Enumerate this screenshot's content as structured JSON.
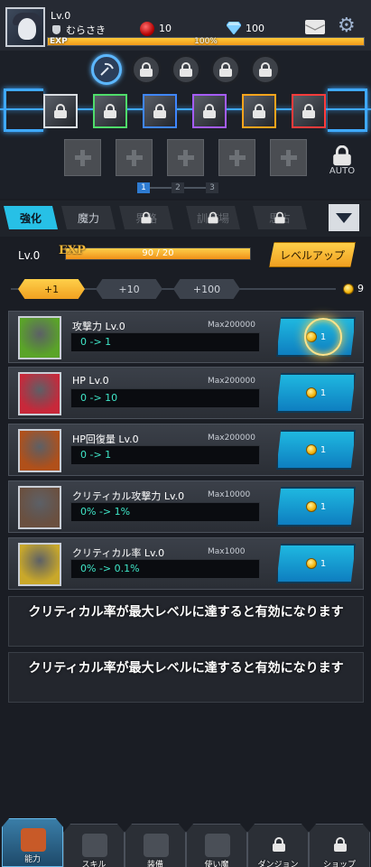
{
  "player": {
    "level": "Lv.0",
    "name": "むらさき",
    "red_gems": "10",
    "diamonds": "100",
    "exp_label": "EXP",
    "exp_percent": "100%",
    "exp_fraction": 1.0
  },
  "equipment": {
    "page_numbers": [
      "1",
      "2",
      "3"
    ],
    "active_page": 0,
    "auto_label": "AUTO",
    "slot_colors": [
      "#d9dde2",
      "#4fdc6a",
      "#3f86ff",
      "#a55cff",
      "#ffa41c",
      "#ff3b3b"
    ]
  },
  "tabs": {
    "strengthen": "強化",
    "magic": "魔力",
    "locked1": "界路",
    "locked2": "訓練場",
    "locked3": "思占"
  },
  "level_row": {
    "level": "Lv.0",
    "exp_tag": "EXP",
    "exp_value": "90 / 20",
    "exp_fraction": 1.0,
    "level_up": "レベルアップ"
  },
  "increments": {
    "options": [
      "+1",
      "+10",
      "+100"
    ],
    "active": 0,
    "coins": "9"
  },
  "upgrades": [
    {
      "title": "攻撃力 Lv.0",
      "max": "Max200000",
      "value": "0 -> 1",
      "cost": "1",
      "icon_color": "#5aa428"
    },
    {
      "title": "HP Lv.0",
      "max": "Max200000",
      "value": "0 -> 10",
      "cost": "1",
      "icon_color": "#c8283a"
    },
    {
      "title": "HP回復量 Lv.0",
      "max": "Max200000",
      "value": "0 -> 1",
      "cost": "1",
      "icon_color": "#b0501a"
    },
    {
      "title": "クリティカル攻撃力 Lv.0",
      "max": "Max10000",
      "value": "0% -> 1%",
      "cost": "1",
      "icon_color": "#6a5040"
    },
    {
      "title": "クリティカル率 Lv.0",
      "max": "Max1000",
      "value": "0% -> 0.1%",
      "cost": "1",
      "icon_color": "#c9a82a"
    }
  ],
  "notices": [
    "クリティカル率が最大レベルに達すると有効になります",
    "クリティカル率が最大レベルに達すると有効になります"
  ],
  "nav": {
    "items": [
      "能力",
      "スキル",
      "装備",
      "使い魔",
      "ダンジョン",
      "ショップ"
    ]
  }
}
